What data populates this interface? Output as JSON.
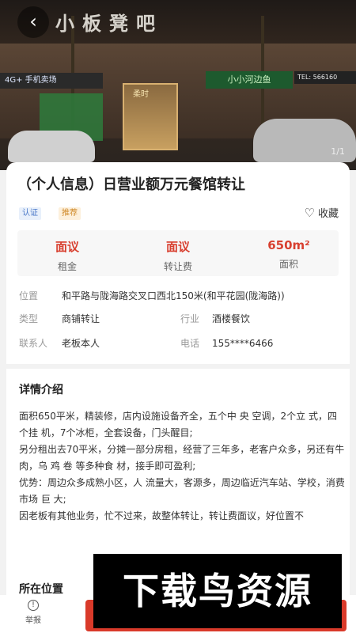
{
  "hero": {
    "sign_text": "小板凳吧",
    "left_sign": "4G+ 手机卖场",
    "store_label": "柔时",
    "green_sign": "小小河边鱼",
    "tel_sign": "TEL: 566160",
    "page_indicator": "1/1"
  },
  "listing": {
    "title": "（个人信息）日营业额万元餐馆转让",
    "tags": [
      "认证",
      "推荐"
    ],
    "favorite_label": "收藏"
  },
  "stats": [
    {
      "value": "面议",
      "label": "租金"
    },
    {
      "value": "面议",
      "label": "转让费"
    },
    {
      "value": "650m²",
      "label": "面积"
    }
  ],
  "info": {
    "location_label": "位置",
    "location_value": "和平路与陇海路交叉口西北150米(和平花园(陇海路))",
    "type_label": "类型",
    "type_value": "商铺转让",
    "industry_label": "行业",
    "industry_value": "酒楼餐饮",
    "contact_label": "联系人",
    "contact_value": "老板本人",
    "phone_label": "电话",
    "phone_value": "155****6466"
  },
  "details": {
    "heading": "详情介绍",
    "paragraphs": [
      "面积650平米，精装修，店内设施设备齐全，五个中 央 空调，2个立 式，四个挂 机，7个冰柜，全套设备，门头醒目;",
      "另分租出去70平米，分摊一部分房租，经营了三年多，老客户众多，另还有牛 肉，乌 鸡 卷 等多种食 材，接手即可盈利;",
      "优势：周边众多成熟小区，人 流量大，客源多，周边临近汽车站、学校，消费市场 巨 大;",
      "因老板有其他业务，忙不过来，故整体转让，转让费面议，好位置不"
    ],
    "location_heading": "所在位置"
  },
  "bottom": {
    "report_label": "举报"
  },
  "watermark": "下载鸟资源"
}
